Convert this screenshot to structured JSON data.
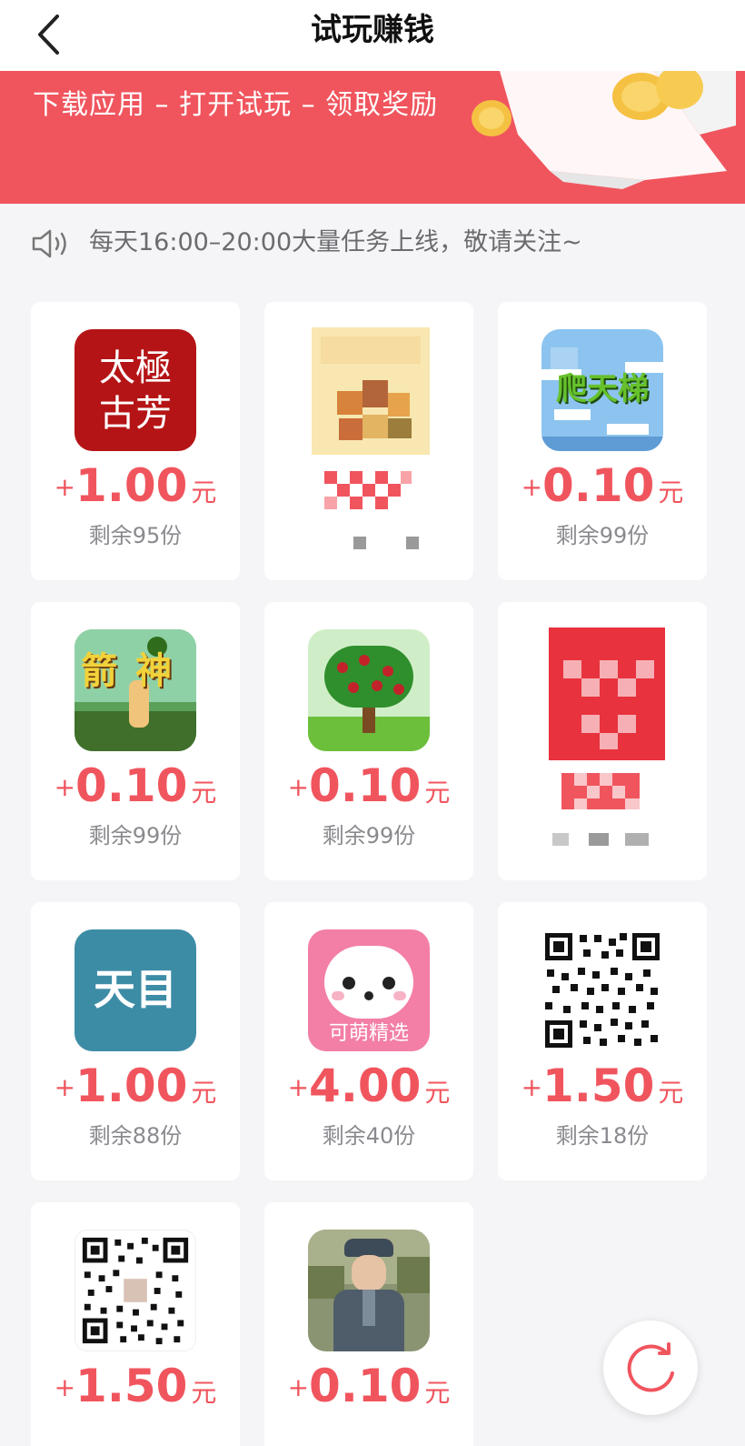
{
  "header": {
    "title": "试玩赚钱"
  },
  "banner": {
    "text": "下载应用 – 打开试玩 – 领取奖励"
  },
  "notice": {
    "text": "每天16:00–20:00大量任务上线，敬请关注~"
  },
  "colors": {
    "accent": "#f0555e",
    "background": "#f5f5f7"
  },
  "tasks": [
    {
      "icon": "taiji-gufang-app-icon",
      "icon_text_line1": "太極",
      "icon_text_line2": "古芳",
      "plus": "+",
      "amount": "1.00",
      "unit": "元",
      "remaining": "剩余95份"
    },
    {
      "icon": "pixelated-app-icon"
    },
    {
      "icon": "pa-tian-ti-app-icon",
      "icon_text": "爬天梯",
      "plus": "+",
      "amount": "0.10",
      "unit": "元",
      "remaining": "剩余99份"
    },
    {
      "icon": "jian-shen-app-icon",
      "icon_text": "箭神",
      "plus": "+",
      "amount": "0.10",
      "unit": "元",
      "remaining": "剩余99份"
    },
    {
      "icon": "fruit-tree-app-icon",
      "plus": "+",
      "amount": "0.10",
      "unit": "元",
      "remaining": "剩余99份"
    },
    {
      "icon": "pixelated-app-icon"
    },
    {
      "icon": "tianmu-app-icon",
      "icon_text": "天目",
      "plus": "+",
      "amount": "1.00",
      "unit": "元",
      "remaining": "剩余88份"
    },
    {
      "icon": "kemeng-jingxuan-app-icon",
      "icon_text": "可萌精选",
      "plus": "+",
      "amount": "4.00",
      "unit": "元",
      "remaining": "剩余40份"
    },
    {
      "icon": "qr-code-icon",
      "plus": "+",
      "amount": "1.50",
      "unit": "元",
      "remaining": "剩余18份"
    },
    {
      "icon": "qr-code-icon",
      "plus": "+",
      "amount": "1.50",
      "unit": "元"
    },
    {
      "icon": "soldier-game-app-icon",
      "plus": "+",
      "amount": "0.10",
      "unit": "元"
    }
  ]
}
